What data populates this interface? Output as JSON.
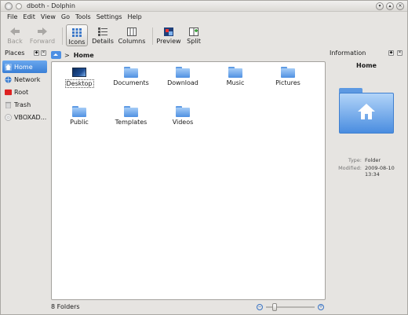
{
  "window": {
    "title": "dboth - Dolphin"
  },
  "menu": [
    "File",
    "Edit",
    "View",
    "Go",
    "Tools",
    "Settings",
    "Help"
  ],
  "toolbar": {
    "back": "Back",
    "forward": "Forward",
    "icons": "Icons",
    "details": "Details",
    "columns": "Columns",
    "preview": "Preview",
    "split": "Split"
  },
  "places": {
    "title": "Places",
    "items": [
      {
        "label": "Home",
        "icon": "home-icon",
        "selected": true
      },
      {
        "label": "Network",
        "icon": "network-icon"
      },
      {
        "label": "Root",
        "icon": "root-icon"
      },
      {
        "label": "Trash",
        "icon": "trash-icon"
      },
      {
        "label": "VBOXAD...",
        "icon": "disc-icon"
      }
    ]
  },
  "breadcrumb": {
    "current": "Home"
  },
  "files": [
    {
      "name": "Desktop",
      "type": "desktop"
    },
    {
      "name": "Documents",
      "type": "folder"
    },
    {
      "name": "Download",
      "type": "folder"
    },
    {
      "name": "Music",
      "type": "folder"
    },
    {
      "name": "Pictures",
      "type": "folder"
    },
    {
      "name": "Public",
      "type": "folder"
    },
    {
      "name": "Templates",
      "type": "folder"
    },
    {
      "name": "Videos",
      "type": "folder"
    }
  ],
  "info": {
    "panel_title": "Information",
    "name": "Home",
    "type_label": "Type:",
    "type_value": "Folder",
    "modified_label": "Modified:",
    "modified_value": "2009-08-10 13:34"
  },
  "status": {
    "text": "8 Folders",
    "zoom_level": 0.15
  },
  "colors": {
    "accent": "#3a7fd6",
    "folder": "#5f9be4"
  }
}
